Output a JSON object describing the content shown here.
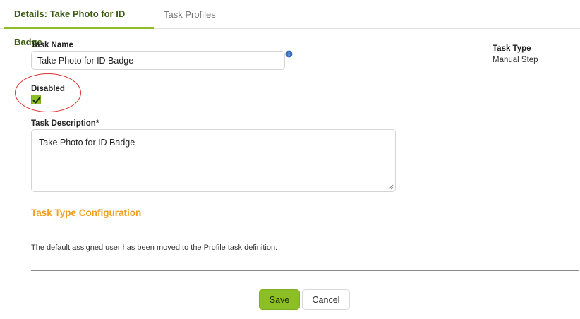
{
  "tabs": {
    "details": "Details: Take Photo for ID Badge",
    "profiles": "Task Profiles"
  },
  "form": {
    "task_name_label": "Task Name",
    "task_name_value": "Take Photo for ID Badge",
    "disabled_label": "Disabled",
    "disabled_checked": true,
    "task_description_label": "Task Description*",
    "task_description_value": "Take Photo for ID Badge",
    "task_type_label": "Task Type",
    "task_type_value": "Manual Step"
  },
  "config": {
    "title": "Task Type Configuration",
    "note": "The default assigned user has been moved to the Profile task definition."
  },
  "buttons": {
    "save": "Save",
    "cancel": "Cancel"
  },
  "colors": {
    "accent_green": "#8cbf26",
    "section_orange": "#f0a01e",
    "annotation_red": "#d33"
  }
}
